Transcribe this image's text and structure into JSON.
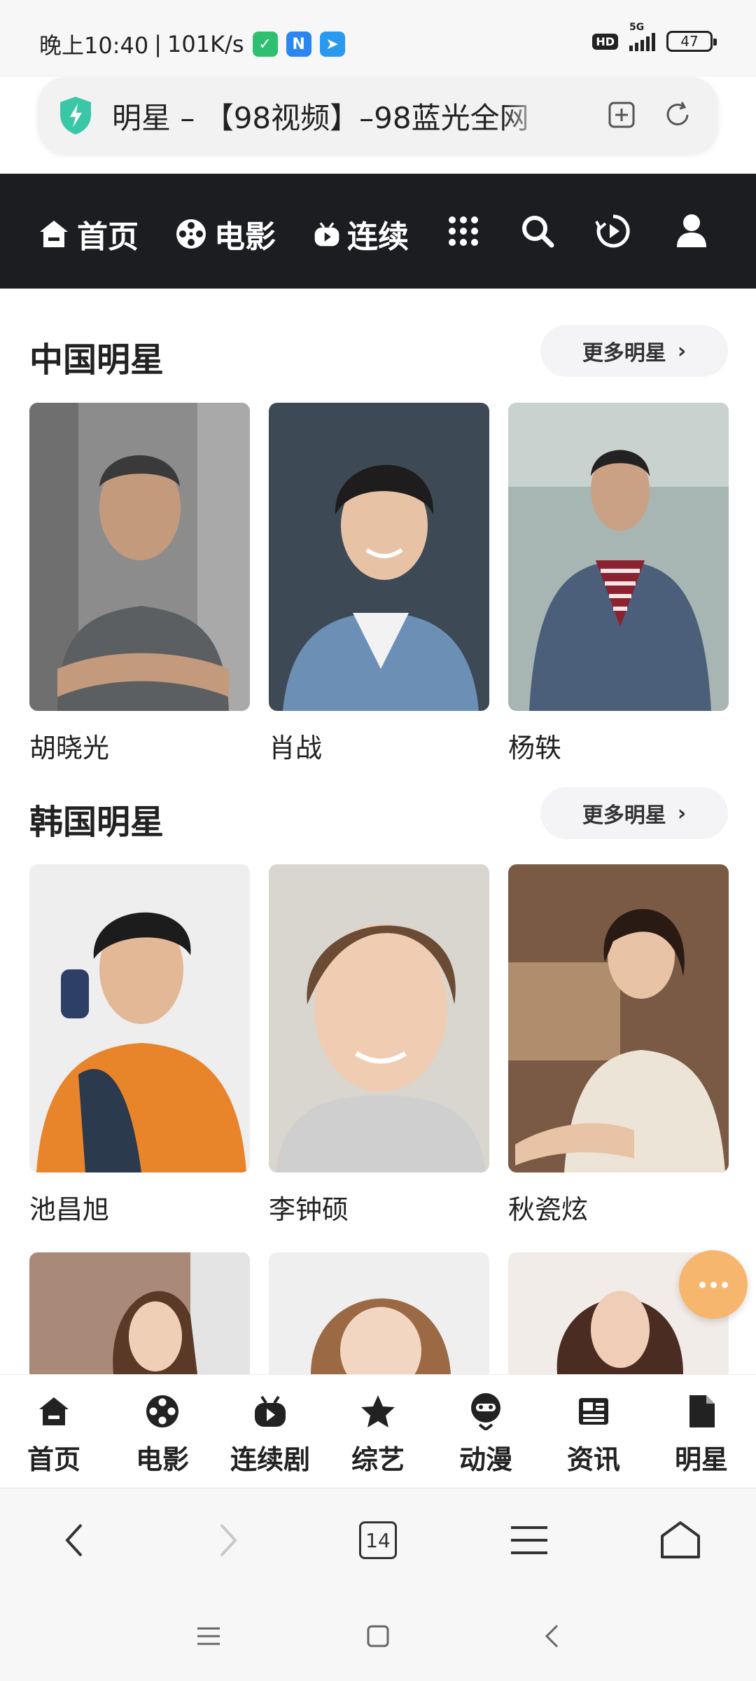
{
  "status_bar": {
    "time": "晚上10:40",
    "separator": "|",
    "speed": "101K/s",
    "hd": "HD",
    "network": "5G",
    "battery": "47"
  },
  "address_bar": {
    "title": "明星 – 【98视频】–98蓝光全网"
  },
  "top_nav": {
    "items": [
      {
        "label": "首页",
        "icon": "home-icon"
      },
      {
        "label": "电影",
        "icon": "film-reel-icon"
      },
      {
        "label": "连续",
        "icon": "tv-icon"
      }
    ],
    "icons": [
      "grid-menu-icon",
      "search-icon",
      "history-play-icon",
      "user-icon"
    ]
  },
  "sections": [
    {
      "title": "中国明星",
      "more": "更多明星",
      "stars": [
        {
          "name": "胡晓光"
        },
        {
          "name": "肖战"
        },
        {
          "name": "杨轶"
        }
      ]
    },
    {
      "title": "韩国明星",
      "more": "更多明星",
      "stars": [
        {
          "name": "池昌旭"
        },
        {
          "name": "李钟硕"
        },
        {
          "name": "秋瓷炫"
        }
      ]
    }
  ],
  "site_tabs": [
    {
      "label": "首页",
      "icon": "home-icon"
    },
    {
      "label": "电影",
      "icon": "film-reel-icon"
    },
    {
      "label": "连续剧",
      "icon": "tv-icon"
    },
    {
      "label": "综艺",
      "icon": "star-icon"
    },
    {
      "label": "动漫",
      "icon": "anime-face-icon"
    },
    {
      "label": "资讯",
      "icon": "news-icon"
    },
    {
      "label": "明星",
      "icon": "document-icon"
    }
  ],
  "browser_bar": {
    "tab_count": "14"
  },
  "colors": {
    "nav_bg": "#1c1d21",
    "fab": "#f7b66e",
    "shield": "#3ac7a7"
  }
}
